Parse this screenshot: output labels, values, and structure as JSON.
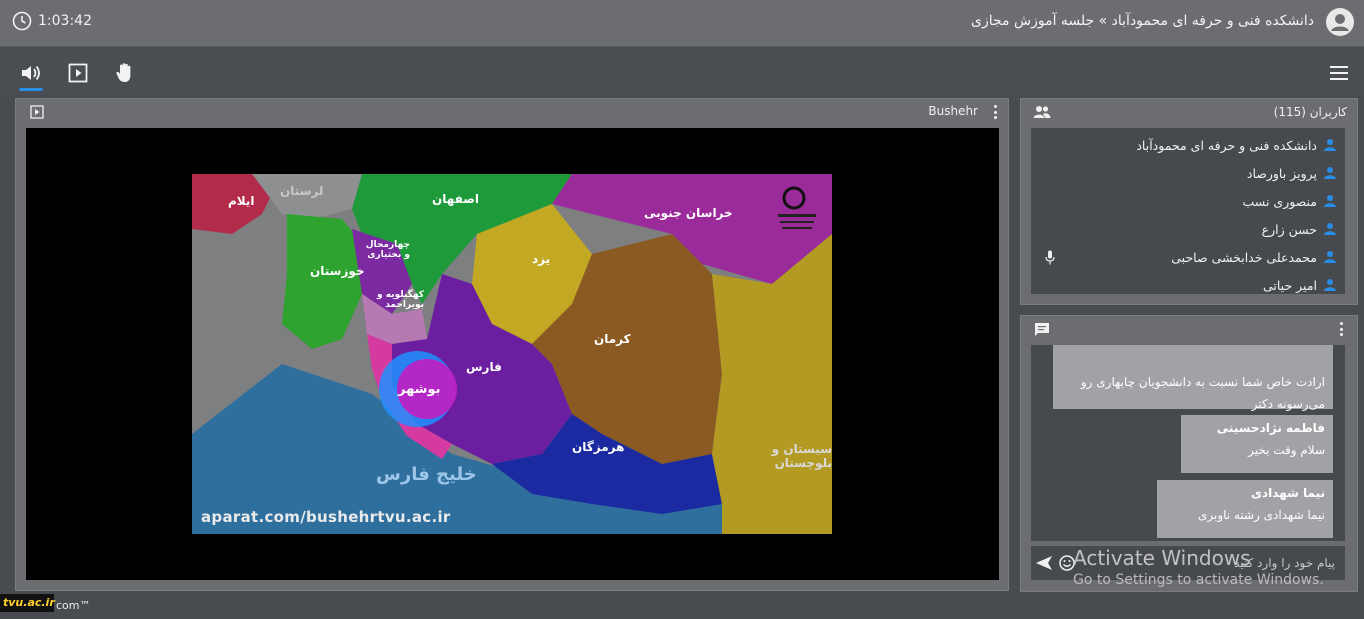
{
  "header": {
    "timer": "1:03:42",
    "title": "دانشکده فنی و حرفه ای محمودآباد » جلسه آموزش مجازی"
  },
  "toolbar": {
    "audio_icon": "speaker-icon",
    "present_icon": "screen-share-icon",
    "raise_hand_icon": "hand-icon",
    "menu_icon": "hamburger-menu-icon",
    "accent": "#2a8de5"
  },
  "video": {
    "title": "Bushehr",
    "map": {
      "labels": [
        "ایلام",
        "لرستان",
        "اصفهان",
        "خراسان جنوبی",
        "چهارمحال و بختیاری",
        "خوزستان",
        "یزد",
        "کهگیلویه و بویراحمد",
        "کرمان",
        "فارس",
        "بوشهر",
        "هرمزگان",
        "سیستان و بلوچستان",
        "خلیج فارس"
      ],
      "url_overlay": "aparat.com/bushehrtvu.ac.ir"
    }
  },
  "users": {
    "title": "کاربران (115)",
    "list": [
      "دانشکده فنی و حرفه ای محمودآباد",
      "پرویز باورصاد",
      "منصوری نسب",
      "حسن زارع",
      "محمدعلی خدابخشی صاحبی",
      "امیر حیاتی"
    ]
  },
  "chat": {
    "messages": [
      {
        "sender": "",
        "text1": "ارادت خاص شما نسبت به دانشجویان چابهاری رو",
        "text2": "می‌رسونه دکتر"
      },
      {
        "sender": "فاطمه نژادحسینی",
        "text1": "سلام وقت بخیر",
        "text2": ""
      },
      {
        "sender": "نیما شهدادی",
        "text1": "نیما شهدادی رشته ناوبری",
        "text2": ""
      }
    ],
    "placeholder": "پیام خود را وارد کنید"
  },
  "overlay": {
    "activate_title": "Activate Windows",
    "activate_sub": "Go to Settings to activate Windows."
  },
  "footer": {
    "logo": "tvu.ac.ir",
    "brand": "com™"
  }
}
